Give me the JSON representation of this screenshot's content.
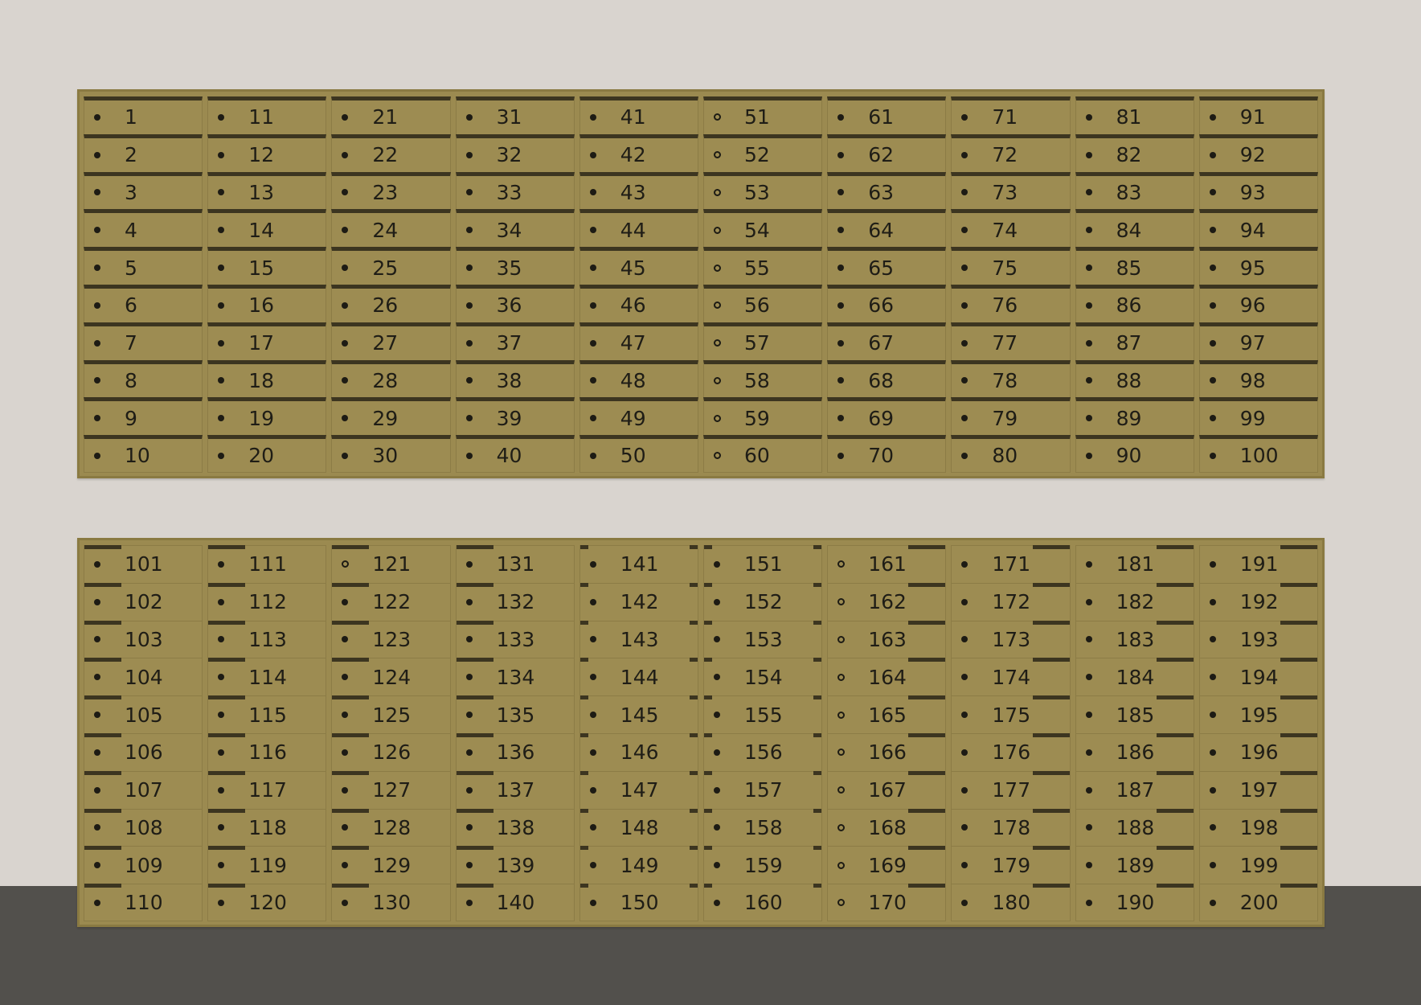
{
  "colors": {
    "wall": "#d9d4cf",
    "floor": "#52504c",
    "box_face": "#9d8c52",
    "box_frame": "#8a7a42",
    "ledge": "#3c3520",
    "text": "#1f1d16"
  },
  "icons": {
    "lock": "keyhole-lock-icon"
  },
  "panels": [
    {
      "name": "upper-mailbox-bank",
      "columns": [
        [
          "1",
          "2",
          "3",
          "4",
          "5",
          "6",
          "7",
          "8",
          "9",
          "10"
        ],
        [
          "11",
          "12",
          "13",
          "14",
          "15",
          "16",
          "17",
          "18",
          "19",
          "20"
        ],
        [
          "21",
          "22",
          "23",
          "24",
          "25",
          "26",
          "27",
          "28",
          "29",
          "30"
        ],
        [
          "31",
          "32",
          "33",
          "34",
          "35",
          "36",
          "37",
          "38",
          "39",
          "40"
        ],
        [
          "41",
          "42",
          "43",
          "44",
          "45",
          "46",
          "47",
          "48",
          "49",
          "50"
        ],
        [
          "51",
          "52",
          "53",
          "54",
          "55",
          "56",
          "57",
          "58",
          "59",
          "60"
        ],
        [
          "61",
          "62",
          "63",
          "64",
          "65",
          "66",
          "67",
          "68",
          "69",
          "70"
        ],
        [
          "71",
          "72",
          "73",
          "74",
          "75",
          "76",
          "77",
          "78",
          "79",
          "80"
        ],
        [
          "81",
          "82",
          "83",
          "84",
          "85",
          "86",
          "87",
          "88",
          "89",
          "90"
        ],
        [
          "91",
          "92",
          "93",
          "94",
          "95",
          "96",
          "97",
          "98",
          "99",
          "100"
        ]
      ]
    },
    {
      "name": "lower-mailbox-bank",
      "columns": [
        [
          "101",
          "102",
          "103",
          "104",
          "105",
          "106",
          "107",
          "108",
          "109",
          "110"
        ],
        [
          "111",
          "112",
          "113",
          "114",
          "115",
          "116",
          "117",
          "118",
          "119",
          "120"
        ],
        [
          "121",
          "122",
          "123",
          "124",
          "125",
          "126",
          "127",
          "128",
          "129",
          "130"
        ],
        [
          "131",
          "132",
          "133",
          "134",
          "135",
          "136",
          "137",
          "138",
          "139",
          "140"
        ],
        [
          "141",
          "142",
          "143",
          "144",
          "145",
          "146",
          "147",
          "148",
          "149",
          "150"
        ],
        [
          "151",
          "152",
          "153",
          "154",
          "155",
          "156",
          "157",
          "158",
          "159",
          "160"
        ],
        [
          "161",
          "162",
          "163",
          "164",
          "165",
          "166",
          "167",
          "168",
          "169",
          "170"
        ],
        [
          "171",
          "172",
          "173",
          "174",
          "175",
          "176",
          "177",
          "178",
          "179",
          "180"
        ],
        [
          "181",
          "182",
          "183",
          "184",
          "185",
          "186",
          "187",
          "188",
          "189",
          "190"
        ],
        [
          "191",
          "192",
          "193",
          "194",
          "195",
          "196",
          "197",
          "198",
          "199",
          "200"
        ]
      ]
    }
  ]
}
